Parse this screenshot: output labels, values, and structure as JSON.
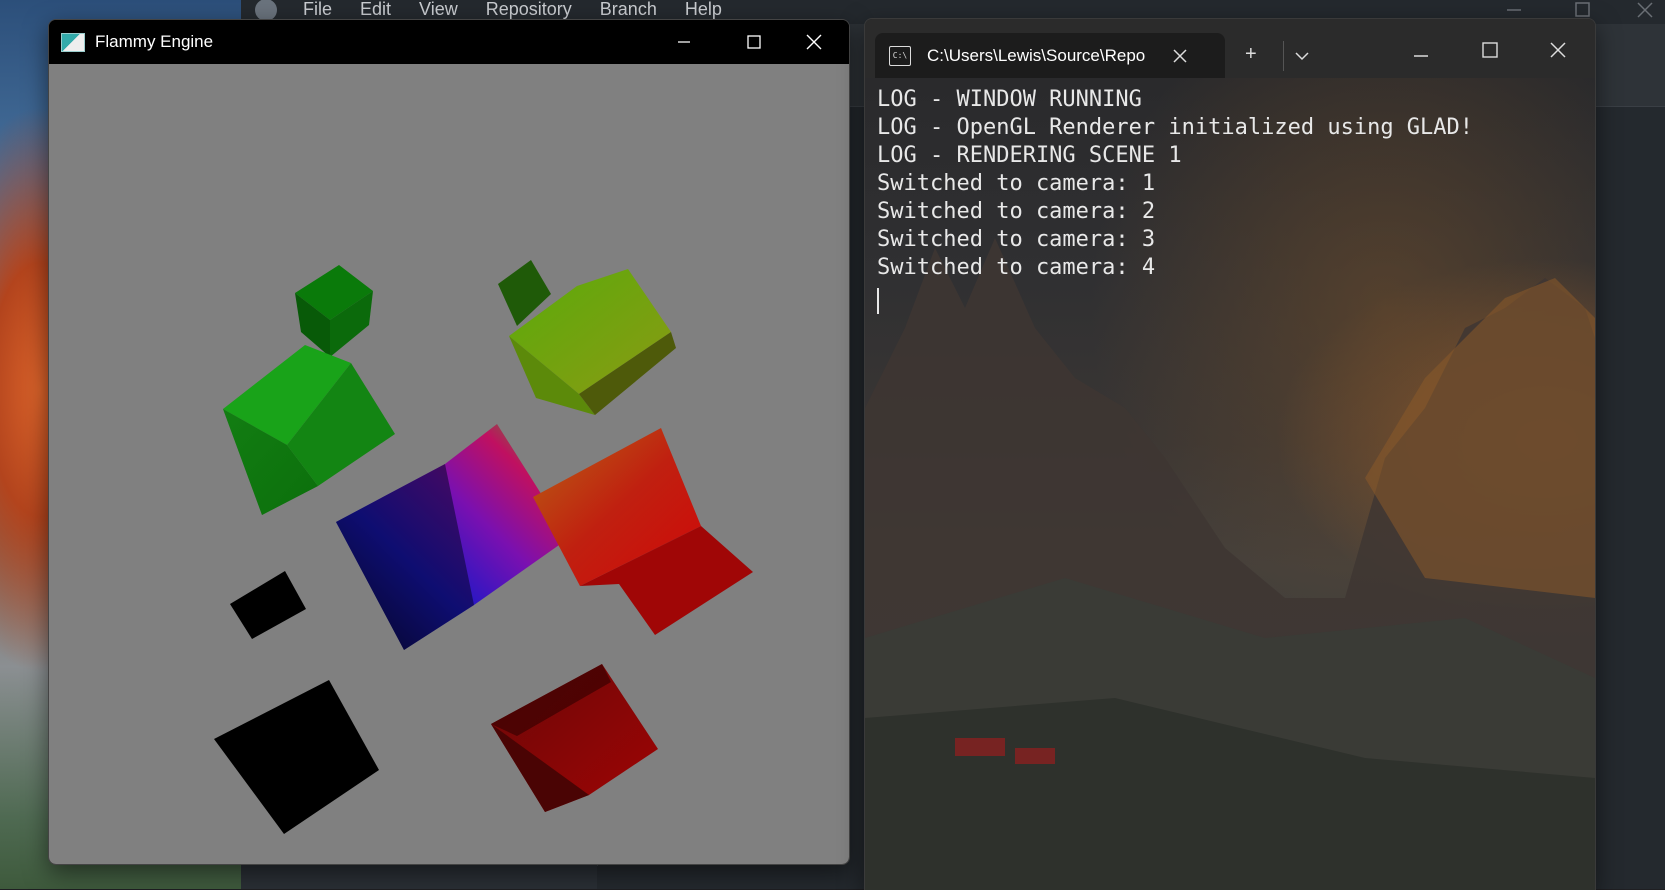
{
  "github_desktop": {
    "menu": [
      "File",
      "Edit",
      "View",
      "Repository",
      "Branch",
      "Help"
    ]
  },
  "flammy_window": {
    "title": "Flammy Engine",
    "minimize_glyph": "—",
    "maximize_glyph": "☐",
    "close_glyph": "✕",
    "background_color": "#808080"
  },
  "terminal": {
    "tab_title": "C:\\Users\\Lewis\\Source\\Repo",
    "tab_icon": "cmd-icon",
    "new_tab_glyph": "+",
    "dropdown_glyph": "⌄",
    "lines": [
      "LOG - WINDOW RUNNING",
      "LOG - OpenGL Renderer initialized using GLAD!",
      "LOG - RENDERING SCENE 1",
      "Switched to camera: 1",
      "Switched to camera: 2",
      "Switched to camera: 3",
      "Switched to camera: 4"
    ]
  }
}
